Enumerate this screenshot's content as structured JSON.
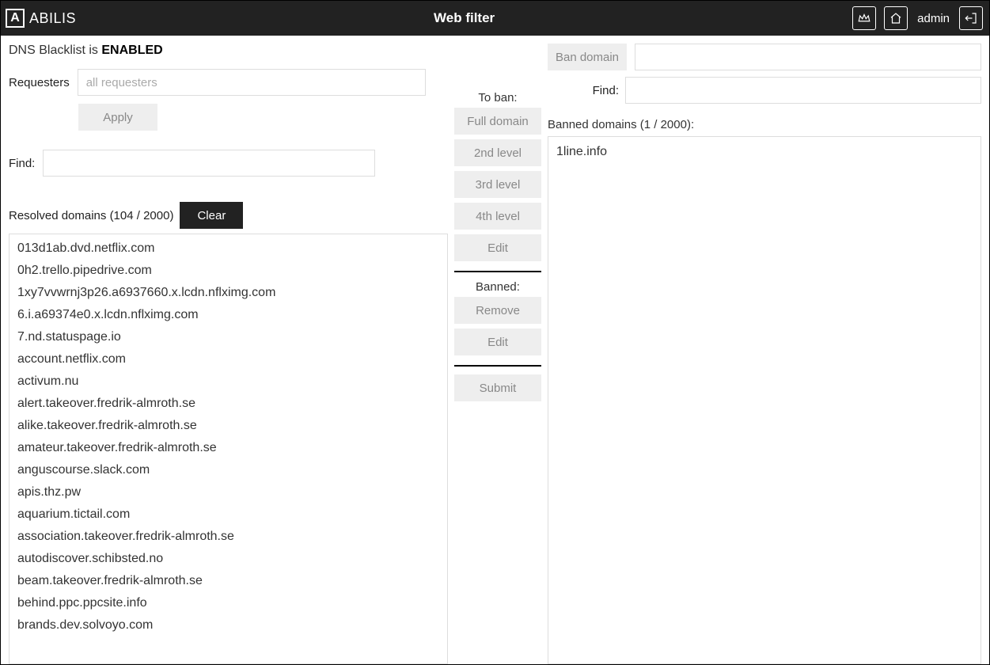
{
  "header": {
    "brand": "ABILIS",
    "title": "Web filter",
    "user": "admin"
  },
  "status": {
    "prefix": "DNS Blacklist is ",
    "value": "ENABLED"
  },
  "left": {
    "requesters_label": "Requesters",
    "requesters_placeholder": "all requesters",
    "apply_label": "Apply",
    "find_label": "Find:",
    "find_value": "",
    "resolved_label": "Resolved domains (104 / 2000)",
    "clear_label": "Clear",
    "resolved_items": [
      "013d1ab.dvd.netflix.com",
      "0h2.trello.pipedrive.com",
      "1xy7vvwrnj3p26.a6937660.x.lcdn.nflximg.com",
      "6.i.a69374e0.x.lcdn.nflximg.com",
      "7.nd.statuspage.io",
      "account.netflix.com",
      "activum.nu",
      "alert.takeover.fredrik-almroth.se",
      "alike.takeover.fredrik-almroth.se",
      "amateur.takeover.fredrik-almroth.se",
      "anguscourse.slack.com",
      "apis.thz.pw",
      "aquarium.tictail.com",
      "association.takeover.fredrik-almroth.se",
      "autodiscover.schibsted.no",
      "beam.takeover.fredrik-almroth.se",
      "behind.ppc.ppcsite.info",
      "brands.dev.solvoyo.com"
    ]
  },
  "mid": {
    "to_ban_label": "To ban:",
    "full_domain": "Full domain",
    "second_level": "2nd level",
    "third_level": "3rd level",
    "fourth_level": "4th level",
    "edit": "Edit",
    "banned_label": "Banned:",
    "remove": "Remove",
    "edit2": "Edit",
    "submit": "Submit"
  },
  "right": {
    "ban_button": "Ban domain",
    "ban_value": "",
    "find_label": "Find:",
    "find_value": "",
    "banned_header": "Banned domains (1 / 2000):",
    "banned_items": [
      "1line.info"
    ]
  }
}
